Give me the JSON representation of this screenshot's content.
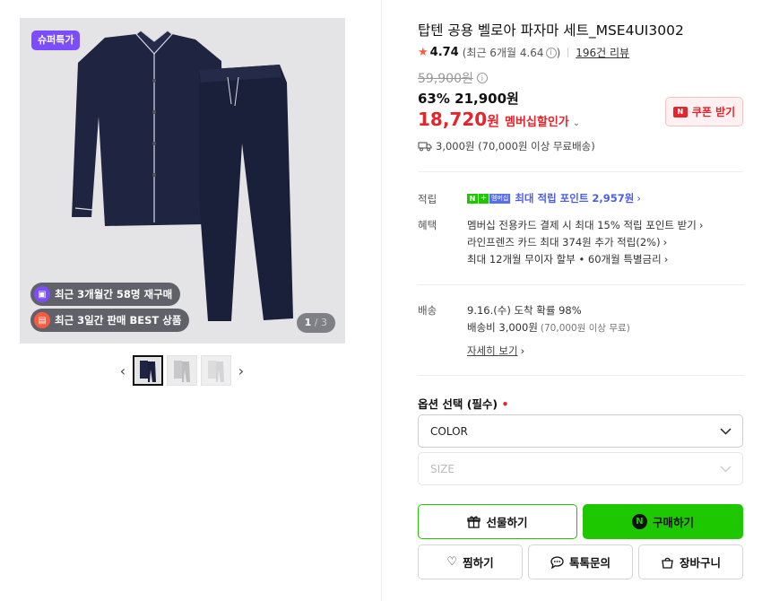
{
  "gallery": {
    "sticker": "슈퍼특가",
    "badge_repurchase": "최근 3개월간 58명 재구매",
    "badge_best": "최근 3일간 판매 BEST 상품",
    "pager_current": "1",
    "pager_total": "/ 3",
    "prev_arrow": "‹",
    "next_arrow": "›"
  },
  "product": {
    "title": "탑텐 공용 벨로아 파자마 세트_MSE4UI3002",
    "rating": "4.74",
    "rating_recent": "(최근 6개월 4.64",
    "rating_recent_close": ")",
    "reviews": "196건 리뷰",
    "original_price": "59,900원",
    "discount": "63%",
    "sale_price": "21,900원",
    "member_price_num": "18,720",
    "member_price_unit": "원",
    "member_label": "멤버십할인가",
    "coupon_label": "쿠폰 받기",
    "shipping": "3,000원 (70,000원 이상 무료배송)"
  },
  "benefits": {
    "points_label": "적립",
    "npay_n": "N",
    "npay_plus": "+",
    "npay_member": "멤버십",
    "points_text": "최대 적립 포인트 2,957원",
    "benefit_label": "혜택",
    "benefit_lines": [
      "멤버십 전용카드 결제 시 최대 15% 적립 포인트 받기",
      "라인프렌즈 카드 최대 374원 추가 적립(2%)",
      "최대 12개월 무이자 할부 • 60개월 특별금리"
    ]
  },
  "delivery": {
    "label": "배송",
    "arrival": "9.16.(수) 도착 확률 98%",
    "fee": "배송비 3,000원",
    "fee_note": "(70,000원 이상 무료)",
    "details_link": "자세히 보기"
  },
  "options": {
    "title": "옵션 선택 (필수)",
    "required_mark": "•",
    "color_label": "COLOR",
    "size_label": "SIZE"
  },
  "actions": {
    "gift": "선물하기",
    "buy": "구매하기",
    "wish": "찜하기",
    "talk": "톡톡문의",
    "cart": "장바구니"
  },
  "colors": {
    "naver_green": "#1ec800",
    "price_red": "#e5242b",
    "point_blue": "#4b5ee8",
    "sticker_purple": "#7c4dff"
  }
}
